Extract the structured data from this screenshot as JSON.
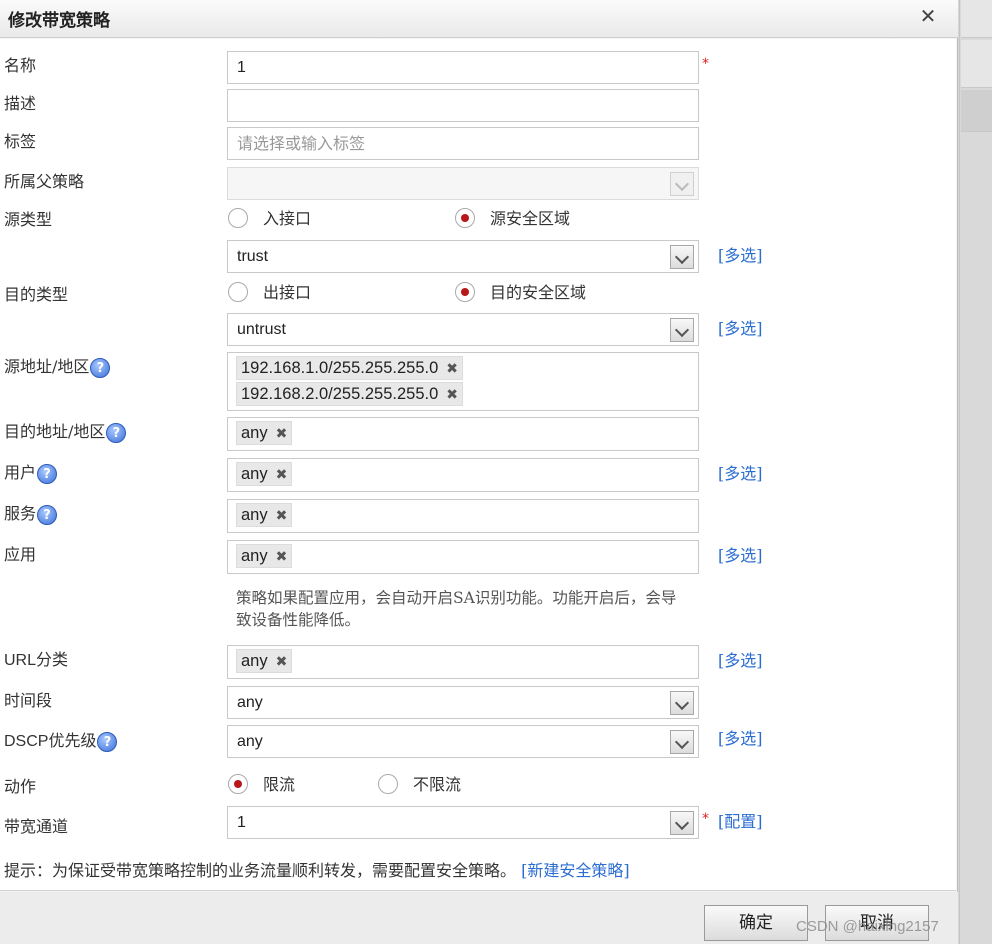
{
  "dialog": {
    "title": "修改带宽策略",
    "close_icon": "close-icon"
  },
  "form": {
    "name": {
      "label": "名称",
      "value": "1"
    },
    "description": {
      "label": "描述",
      "value": ""
    },
    "tags": {
      "label": "标签",
      "placeholder": "请选择或输入标签"
    },
    "parent": {
      "label": "所属父策略",
      "value": ""
    },
    "source_type": {
      "label": "源类型",
      "options": [
        "入接口",
        "源安全区域"
      ],
      "selected": "源安全区域",
      "select_value": "trust",
      "multi": "[多选]"
    },
    "dest_type": {
      "label": "目的类型",
      "options": [
        "出接口",
        "目的安全区域"
      ],
      "selected": "目的安全区域",
      "select_value": "untrust",
      "multi": "[多选]"
    },
    "src_addr": {
      "label": "源地址/地区",
      "tags": [
        "192.168.1.0/255.255.255.0",
        "192.168.2.0/255.255.255.0"
      ]
    },
    "dst_addr": {
      "label": "目的地址/地区",
      "tags": [
        "any"
      ]
    },
    "user": {
      "label": "用户",
      "tags": [
        "any"
      ],
      "multi": "[多选]"
    },
    "service": {
      "label": "服务",
      "tags": [
        "any"
      ]
    },
    "application": {
      "label": "应用",
      "tags": [
        "any"
      ],
      "multi": "[多选]",
      "note": "策略如果配置应用，会自动开启SA识别功能。功能开启后，会导致设备性能降低。"
    },
    "url_category": {
      "label": "URL分类",
      "tags": [
        "any"
      ],
      "multi": "[多选]"
    },
    "schedule": {
      "label": "时间段",
      "value": "any"
    },
    "dscp": {
      "label": "DSCP优先级",
      "value": "any",
      "multi": "[多选]"
    },
    "action": {
      "label": "动作",
      "options": [
        "限流",
        "不限流"
      ],
      "selected": "限流"
    },
    "channel": {
      "label": "带宽通道",
      "value": "1",
      "config": "[配置]"
    }
  },
  "hint": {
    "text": "提示：为保证受带宽策略控制的业务流量顺利转发，需要配置安全策略。",
    "link": "[新建安全策略]"
  },
  "buttons": {
    "ok": "确定",
    "cancel": "取消"
  },
  "watermark": "CSDN @haixing2157",
  "help_icon_glyph": "?",
  "tag_remove_glyph": "✖",
  "colors": {
    "link": "#2b6dd0",
    "required": "#e02020",
    "radio_dot": "#b81818"
  }
}
